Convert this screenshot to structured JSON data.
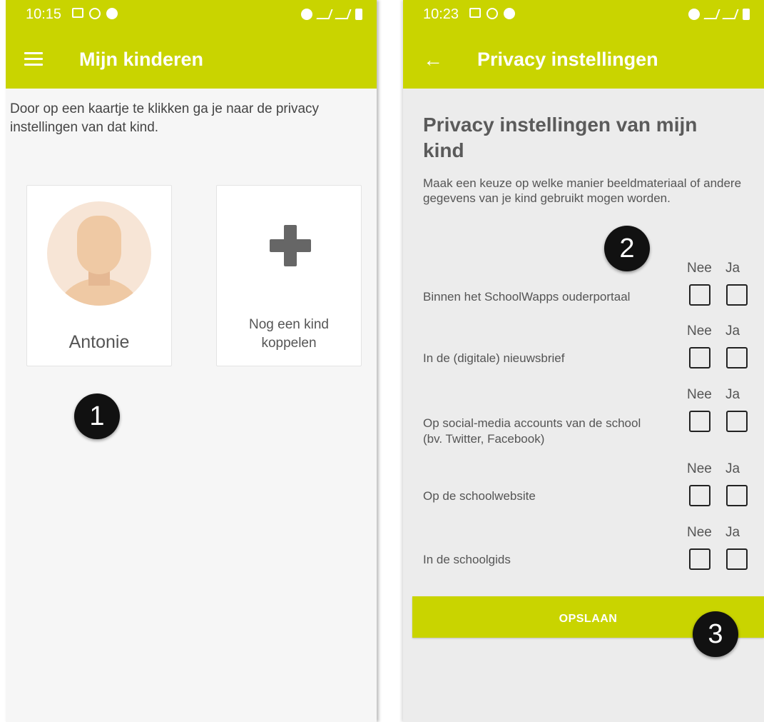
{
  "left_screen": {
    "status_time": "10:15",
    "title": "Mijn kinderen",
    "intro": "Door op een kaartje te klikken ga je naar de privacy instellingen van dat kind.",
    "child_card": {
      "name": "Antonie"
    },
    "add_card": {
      "label_line1": "Nog een kind",
      "label_line2": "koppelen"
    },
    "badge": "1"
  },
  "right_screen": {
    "status_time": "10:23",
    "title": "Privacy instellingen",
    "heading_line1": "Privacy instellingen van mijn",
    "heading_line2": "kind",
    "description": "Maak een keuze op welke manier beeldmateriaal of andere gegevens van je kind gebruikt mogen worden.",
    "column_no": "Nee",
    "column_yes": "Ja",
    "rows": [
      {
        "label": "Binnen het SchoolWapps ouderportaal",
        "no": false,
        "yes": false
      },
      {
        "label": "In de (digitale) nieuwsbrief",
        "no": false,
        "yes": false
      },
      {
        "label": "Op social-media accounts van de school (bv. Twitter, Facebook)",
        "no": false,
        "yes": false
      },
      {
        "label": "Op de schoolwebsite",
        "no": false,
        "yes": false
      },
      {
        "label": "In de schoolgids",
        "no": false,
        "yes": false
      }
    ],
    "save_label": "OPSLAAN",
    "badge_2": "2",
    "badge_3": "3"
  },
  "icons": {
    "menu": "hamburger-menu-icon",
    "back": "back-arrow-icon",
    "add": "plus-icon",
    "avatar": "person-silhouette-icon"
  },
  "colors": {
    "accent": "#c9d400",
    "badge": "#111111"
  }
}
